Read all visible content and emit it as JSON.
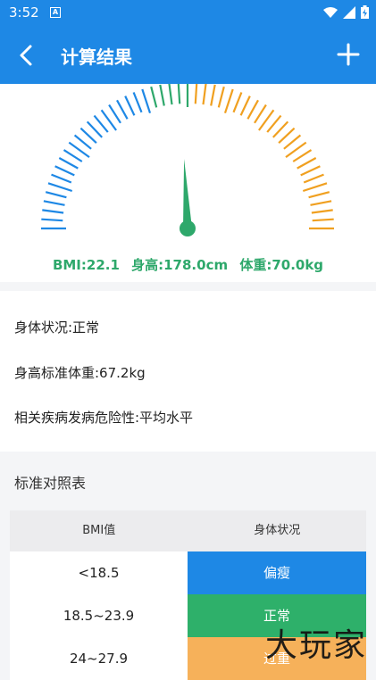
{
  "status_bar": {
    "time": "3:52",
    "notification_icon": "a-box-icon",
    "icons": [
      "wifi-icon",
      "signal-icon",
      "battery-charging-icon"
    ]
  },
  "app_bar": {
    "title": "计算结果",
    "back_icon": "chevron-left-icon",
    "action_icon": "plus-icon"
  },
  "gauge": {
    "value": 22.1,
    "scale_colors": [
      "#1e88e5",
      "#2ea86b",
      "#f0a020"
    ]
  },
  "summary": {
    "bmi": "BMI:22.1",
    "height": "身高:178.0cm",
    "weight": "体重:70.0kg"
  },
  "info": {
    "condition": "身体状况:正常",
    "standard_weight": "身高标准体重:67.2kg",
    "risk": "相关疾病发病危险性:平均水平"
  },
  "reference": {
    "title": "标准对照表",
    "headers": [
      "BMI值",
      "身体状况"
    ],
    "rows": [
      {
        "range": "<18.5",
        "status": "偏瘦",
        "color": "#1e88e5"
      },
      {
        "range": "18.5~23.9",
        "status": "正常",
        "color": "#2eb06a"
      },
      {
        "range": "24~27.9",
        "status": "过重",
        "color": "#f6b15a"
      }
    ]
  },
  "watermark": "大玩家"
}
